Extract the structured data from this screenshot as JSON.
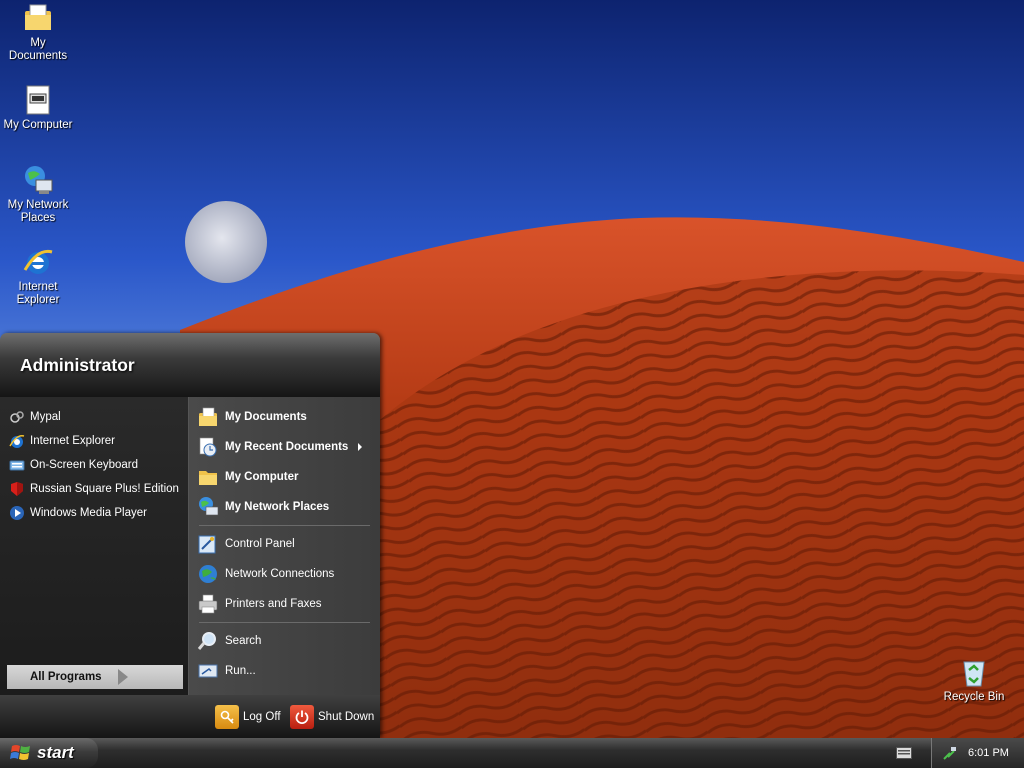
{
  "desktop": {
    "icons": [
      {
        "label": "My Documents",
        "icon": "folder-documents-icon"
      },
      {
        "label": "My Computer",
        "icon": "computer-icon"
      },
      {
        "label": "My Network Places",
        "icon": "network-places-icon"
      },
      {
        "label": "Internet Explorer",
        "icon": "internet-explorer-icon"
      },
      {
        "label": "Recycle Bin",
        "icon": "recycle-bin-icon"
      }
    ]
  },
  "start_menu": {
    "user_name": "Administrator",
    "pinned": [
      {
        "label": "Mypal",
        "icon": "mypal-icon"
      },
      {
        "label": "Internet Explorer",
        "icon": "internet-explorer-icon"
      },
      {
        "label": "On-Screen Keyboard",
        "icon": "keyboard-icon"
      },
      {
        "label": "Russian Square Plus! Edition",
        "icon": "russian-square-icon"
      },
      {
        "label": "Windows Media Player",
        "icon": "media-player-icon"
      }
    ],
    "all_programs_label": "All Programs",
    "right": {
      "my_documents": "My Documents",
      "my_recent_documents": "My Recent Documents",
      "my_computer": "My Computer",
      "my_network_places": "My Network Places",
      "control_panel": "Control Panel",
      "network_connections": "Network Connections",
      "printers_faxes": "Printers and Faxes",
      "search": "Search",
      "run": "Run..."
    },
    "log_off_label": "Log Off",
    "shut_down_label": "Shut Down"
  },
  "taskbar": {
    "start_label": "start",
    "clock": "6:01 PM"
  },
  "colors": {
    "dune": "#c0401a",
    "dune_dark": "#8a2a10",
    "sky": "#1d44b8",
    "log_off": "#e5a22a",
    "shut_down": "#d9321f"
  }
}
